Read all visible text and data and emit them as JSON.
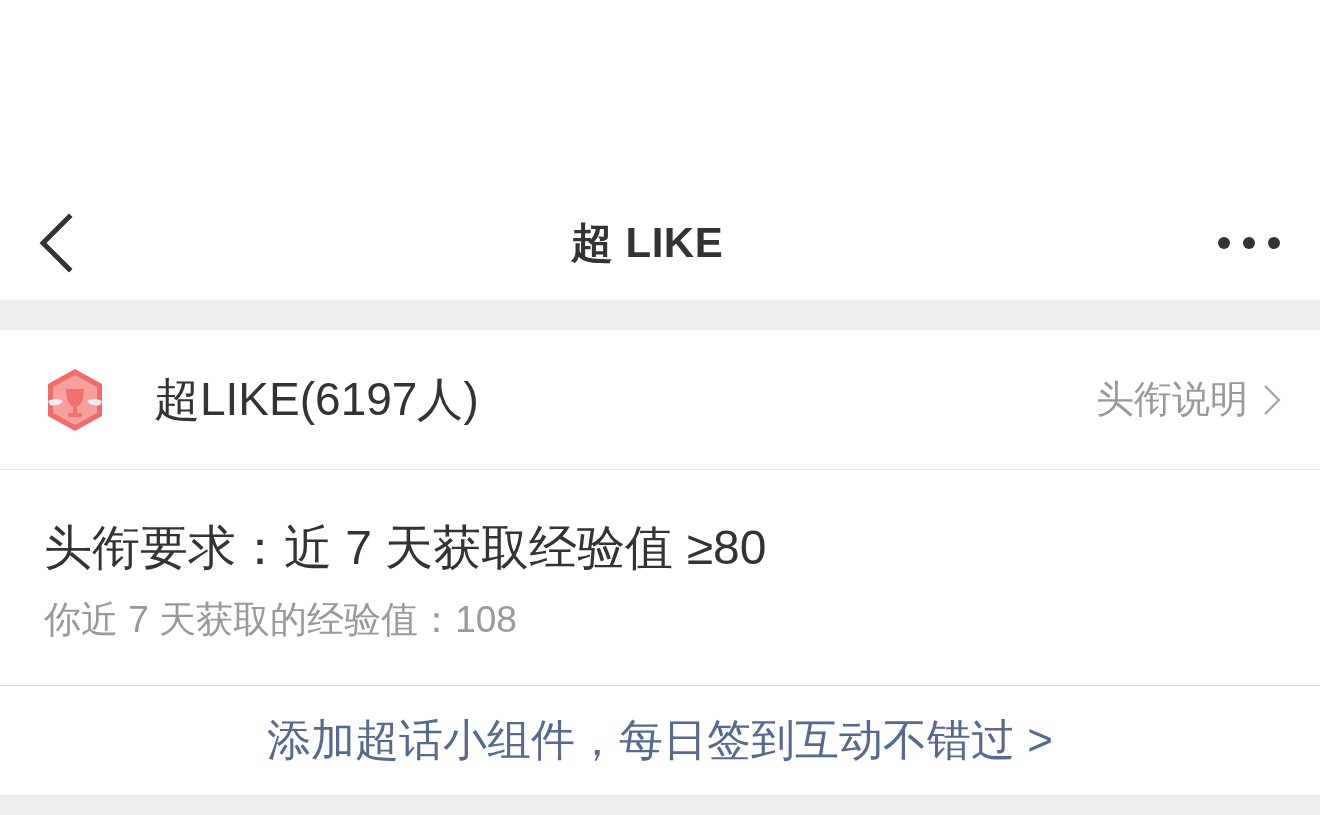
{
  "nav": {
    "title": "超 LIKE"
  },
  "title_row": {
    "name": "超LIKE(6197人)",
    "link": "头衔说明"
  },
  "requirement": {
    "text": "头衔要求：近 7 天获取经验值 ≥80",
    "progress": "你近 7 天获取的经验值：108"
  },
  "promo_link": "添加超话小组件，每日签到互动不错过 >"
}
